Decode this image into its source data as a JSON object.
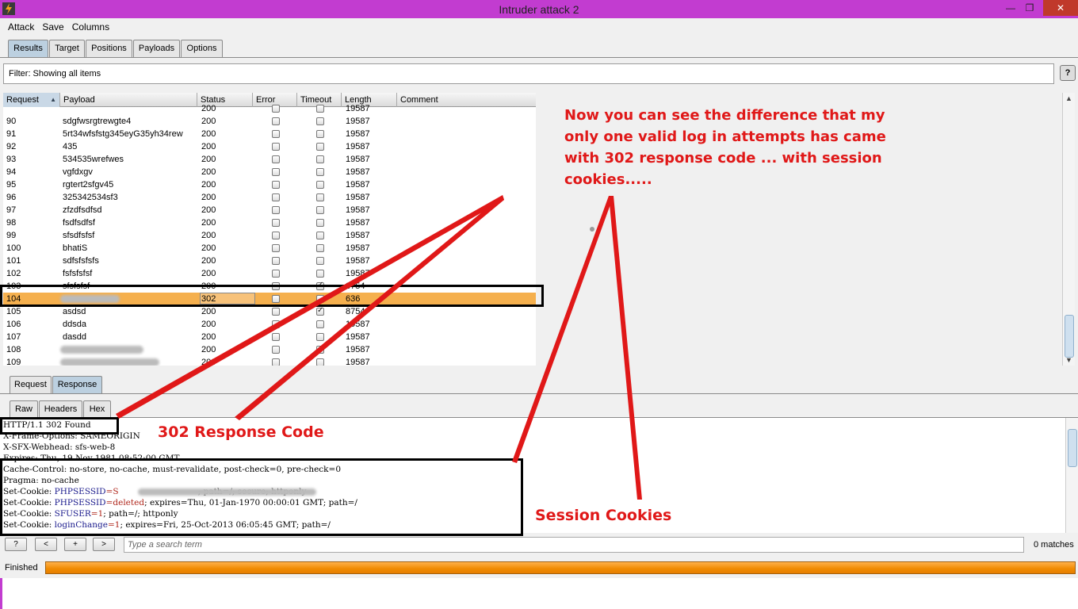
{
  "window": {
    "title": "Intruder attack 2",
    "minimize": "—",
    "maximize": "❐",
    "close": "✕"
  },
  "menu": [
    "Attack",
    "Save",
    "Columns"
  ],
  "main_tabs": [
    "Results",
    "Target",
    "Positions",
    "Payloads",
    "Options"
  ],
  "filter": {
    "text": "Filter:  Showing all items",
    "help": "?"
  },
  "columns": [
    "Request",
    "Payload",
    "Status",
    "Error",
    "Timeout",
    "Length",
    "Comment"
  ],
  "rows": [
    {
      "request": "",
      "payload": "",
      "status": "200",
      "length": "19587",
      "timeout": false
    },
    {
      "request": "90",
      "payload": "sdgfwsrgtrewgte4",
      "status": "200",
      "length": "19587",
      "timeout": false
    },
    {
      "request": "91",
      "payload": "5rt34wfsfstg345eyG35yh34rew",
      "status": "200",
      "length": "19587",
      "timeout": false
    },
    {
      "request": "92",
      "payload": "435",
      "status": "200",
      "length": "19587",
      "timeout": false
    },
    {
      "request": "93",
      "payload": "534535wrefwes",
      "status": "200",
      "length": "19587",
      "timeout": false
    },
    {
      "request": "94",
      "payload": "vgfdxgv",
      "status": "200",
      "length": "19587",
      "timeout": false
    },
    {
      "request": "95",
      "payload": "rgtert2sfgv45",
      "status": "200",
      "length": "19587",
      "timeout": false
    },
    {
      "request": "96",
      "payload": "325342534sf3",
      "status": "200",
      "length": "19587",
      "timeout": false
    },
    {
      "request": "97",
      "payload": "zfzdfsdfsd",
      "status": "200",
      "length": "19587",
      "timeout": false
    },
    {
      "request": "98",
      "payload": "fsdfsdfsf",
      "status": "200",
      "length": "19587",
      "timeout": false
    },
    {
      "request": "99",
      "payload": "sfsdfsfsf",
      "status": "200",
      "length": "19587",
      "timeout": false
    },
    {
      "request": "100",
      "payload": "bhatiS",
      "status": "200",
      "length": "19587",
      "timeout": false
    },
    {
      "request": "101",
      "payload": "sdfsfsfsfs",
      "status": "200",
      "length": "19587",
      "timeout": false
    },
    {
      "request": "102",
      "payload": "fsfsfsfsf",
      "status": "200",
      "length": "19587",
      "timeout": false
    },
    {
      "request": "103",
      "payload": "sfsfsfsf",
      "status": "200",
      "length": "8754",
      "timeout": true
    },
    {
      "request": "104",
      "payload": "",
      "status": "302",
      "length": "636",
      "timeout": false,
      "selected": true
    },
    {
      "request": "105",
      "payload": "asdsd",
      "status": "200",
      "length": "8754",
      "timeout": true
    },
    {
      "request": "106",
      "payload": "ddsda",
      "status": "200",
      "length": "19587",
      "timeout": false
    },
    {
      "request": "107",
      "payload": "dasdd",
      "status": "200",
      "length": "19587",
      "timeout": false
    },
    {
      "request": "108",
      "payload": "",
      "status": "200",
      "length": "19587",
      "timeout": false
    },
    {
      "request": "109",
      "payload": "",
      "status": "200",
      "length": "19587",
      "timeout": false
    }
  ],
  "req_tabs": [
    "Request",
    "Response"
  ],
  "view_tabs": [
    "Raw",
    "Headers",
    "Hex"
  ],
  "response_lines": [
    {
      "pre": "HTTP/1.1 302 Found",
      "key": "",
      "val": "",
      "post": ""
    },
    {
      "pre": "X-Frame-Options: SAMEORIGIN",
      "key": "",
      "val": "",
      "post": ""
    },
    {
      "pre": "X-SFX-Webhead: sfs-web-8",
      "key": "",
      "val": "",
      "post": ""
    },
    {
      "pre": "Expires: Thu, 19 Nov 1981 08:52:00 GMT",
      "key": "",
      "val": "",
      "post": ""
    },
    {
      "pre": "Cache-Control: no-store, no-cache, must-revalidate, post-check=0, pre-check=0",
      "key": "",
      "val": "",
      "post": ""
    },
    {
      "pre": "Pragma: no-cache",
      "key": "",
      "val": "",
      "post": ""
    },
    {
      "pre": "Set-Cookie: ",
      "key": "PHPSESSID",
      "val": "=S",
      "post": "                              ; path=/; secure; httponly"
    },
    {
      "pre": "Set-Cookie: ",
      "key": "PHPSESSID",
      "val": "=deleted",
      "post": "; expires=Thu, 01-Jan-1970 00:00:01 GMT; path=/"
    },
    {
      "pre": "Set-Cookie: ",
      "key": "SFUSER",
      "val": "=1",
      "post": "; path=/; httponly"
    },
    {
      "pre": "Set-Cookie: ",
      "key": "loginChange",
      "val": "=1",
      "post": "; expires=Fri, 25-Oct-2013 06:05:45 GMT; path=/"
    }
  ],
  "search": {
    "buttons": [
      "?",
      "<",
      "+",
      ">"
    ],
    "placeholder": "Type a search term",
    "matches": "0 matches"
  },
  "status": {
    "label": "Finished",
    "progress": 1.0
  },
  "annotations": {
    "main_note": "Now you can see the difference that my only one valid log in attempts has came with 302 response code ... with session cookies.....",
    "code_label": "302 Response Code",
    "cookies_label": "Session Cookies"
  },
  "colors": {
    "titlebar": "#c23cd0",
    "selected_row": "#f5b04e",
    "annotation": "#e01818",
    "progress": "#f08a00"
  }
}
